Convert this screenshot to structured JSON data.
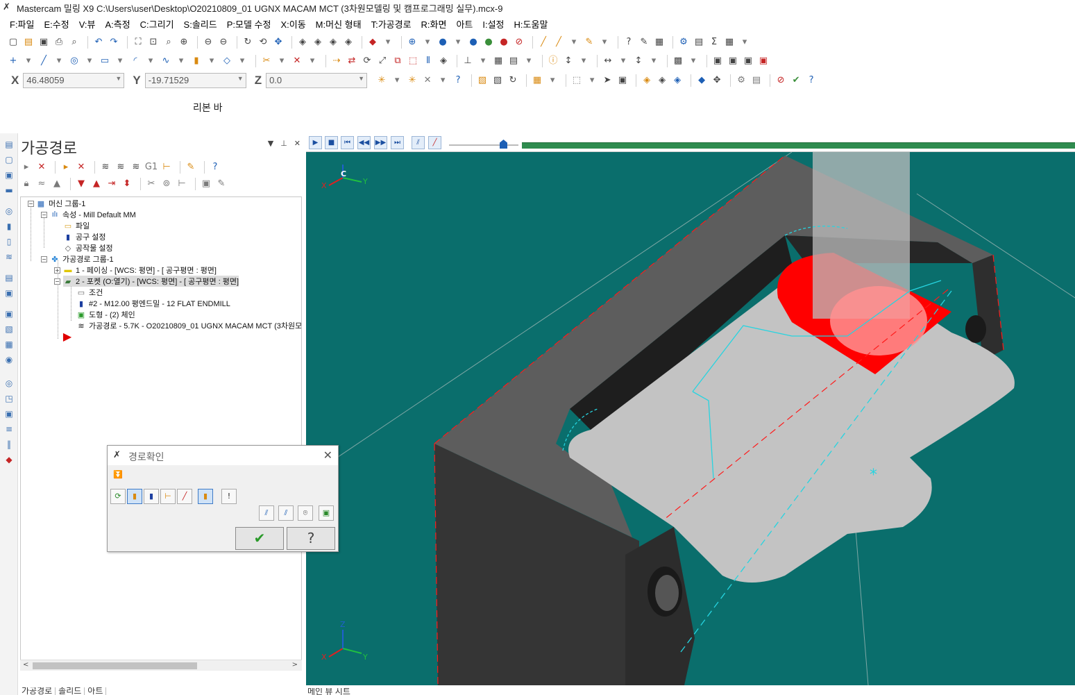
{
  "window": {
    "title": "Mastercam 밀링 X9  C:\\Users\\user\\Desktop\\O20210809_01 UGNX MACAM MCT (3차원모델링 및 캠프로그래밍 실무).mcx-9"
  },
  "menu": [
    {
      "label": "F:파일"
    },
    {
      "label": "E:수정"
    },
    {
      "label": "V:뷰"
    },
    {
      "label": "A:측정"
    },
    {
      "label": "C:그리기"
    },
    {
      "label": "S:솔리드"
    },
    {
      "label": "P:모델 수정"
    },
    {
      "label": "X:이동"
    },
    {
      "label": "M:머신 형태"
    },
    {
      "label": "T:가공경로"
    },
    {
      "label": "R:화면"
    },
    {
      "label": "아트"
    },
    {
      "label": "I:설정"
    },
    {
      "label": "H:도움말"
    }
  ],
  "coords": {
    "x_label": "X",
    "x_value": "46.48059",
    "y_label": "Y",
    "y_value": "-19.71529",
    "z_label": "Z",
    "z_value": "0.0"
  },
  "ribbon": {
    "label": "리본 바"
  },
  "toolpath_manager": {
    "title": "가공경로",
    "tree": {
      "machine_group": "머신 그룹-1",
      "properties": "속성 - Mill Default MM",
      "files": "파일",
      "tool_settings": "공구 설정",
      "stock_setup": "공작물 설정",
      "toolpath_group": "가공경로 그룹-1",
      "op1": "1 - 페이싱 - [WCS: 평면] - [  공구평면 : 평면]",
      "op2": "2 - 포켓 (O:열기) - [WCS: 평면] - [  공구평면 : 평면]",
      "op2_params": "조건",
      "op2_tool": "#2 - M12.00 평엔드밀 - 12 FLAT ENDMILL",
      "op2_geometry": "도형 - (2) 체인",
      "op2_toolpath": "가공경로 - 5.7K - O20210809_01 UGNX MACAM MCT (3차원모"
    },
    "bottom_tabs": [
      {
        "label": "가공경로"
      },
      {
        "label": "솔리드"
      },
      {
        "label": "아트"
      }
    ]
  },
  "viewport": {
    "bottom_tab": "메인 뷰 시트",
    "axis_top": {
      "x": "X",
      "y": "Y",
      "c": "C"
    },
    "axis_bottom": {
      "x": "X",
      "y": "Y",
      "z": "Z"
    },
    "colors": {
      "background": "#0a6e6c",
      "part_dark": "#3b3b3b",
      "part_light": "#c6c6c6",
      "tool_red": "#ff0000",
      "toolpath_cyan": "#26d4e0"
    }
  },
  "dialog": {
    "title": "경로확인",
    "ok_icon": "checkmark-icon",
    "help_icon": "question-icon"
  }
}
